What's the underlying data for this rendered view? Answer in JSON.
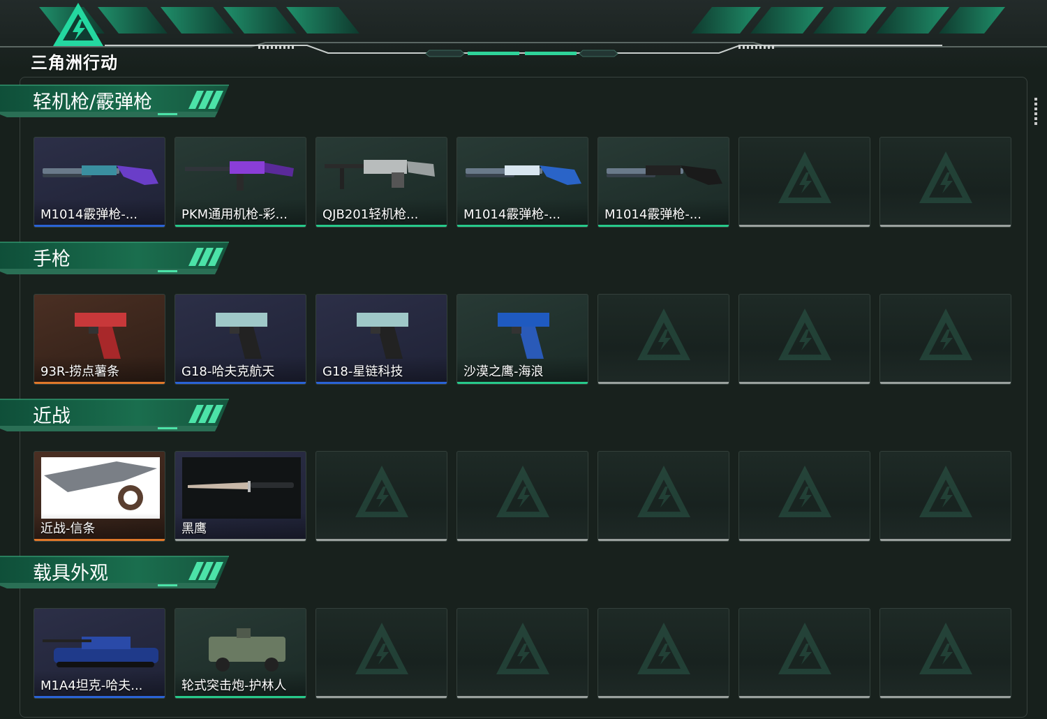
{
  "header": {
    "logo_text": "三角洲行动",
    "brand_color": "#2fd49a"
  },
  "colors": {
    "quality_blue": "#2a63d6",
    "quality_green": "#27c98a",
    "quality_orange": "#e0782a",
    "quality_empty": "#9aa19e"
  },
  "sections": [
    {
      "title": "轻机枪/霰弹枪",
      "items": [
        {
          "name": "M1014霰弹枪-...",
          "quality": "blue",
          "icon": "shotgun-icon"
        },
        {
          "name": "PKM通用机枪-彩...",
          "quality": "green",
          "icon": "machine-gun-icon"
        },
        {
          "name": "QJB201轻机枪...",
          "quality": "green",
          "icon": "light-machine-gun-icon"
        },
        {
          "name": "M1014霰弹枪-...",
          "quality": "green",
          "icon": "shotgun-icon"
        },
        {
          "name": "M1014霰弹枪-...",
          "quality": "green",
          "icon": "shotgun-icon"
        },
        {
          "name": "",
          "quality": "empty",
          "icon": "empty-slot-icon"
        },
        {
          "name": "",
          "quality": "empty",
          "icon": "empty-slot-icon"
        }
      ]
    },
    {
      "title": "手枪",
      "items": [
        {
          "name": "93R-捞点薯条",
          "quality": "orange",
          "icon": "pistol-icon"
        },
        {
          "name": "G18-哈夫克航天",
          "quality": "blue",
          "icon": "pistol-icon"
        },
        {
          "name": "G18-星链科技",
          "quality": "blue",
          "icon": "pistol-icon"
        },
        {
          "name": "沙漠之鹰-海浪",
          "quality": "green",
          "icon": "pistol-icon"
        },
        {
          "name": "",
          "quality": "empty",
          "icon": "empty-slot-icon"
        },
        {
          "name": "",
          "quality": "empty",
          "icon": "empty-slot-icon"
        },
        {
          "name": "",
          "quality": "empty",
          "icon": "empty-slot-icon"
        }
      ]
    },
    {
      "title": "近战",
      "items": [
        {
          "name": "近战-信条",
          "quality": "orange",
          "icon": "knife-icon"
        },
        {
          "name": "黑鹰",
          "quality": "empty",
          "icon": "knife-icon"
        },
        {
          "name": "",
          "quality": "empty",
          "icon": "empty-slot-icon"
        },
        {
          "name": "",
          "quality": "empty",
          "icon": "empty-slot-icon"
        },
        {
          "name": "",
          "quality": "empty",
          "icon": "empty-slot-icon"
        },
        {
          "name": "",
          "quality": "empty",
          "icon": "empty-slot-icon"
        },
        {
          "name": "",
          "quality": "empty",
          "icon": "empty-slot-icon"
        }
      ]
    },
    {
      "title": "载具外观",
      "items": [
        {
          "name": "M1A4坦克-哈夫...",
          "quality": "blue",
          "icon": "tank-icon"
        },
        {
          "name": "轮式突击炮-护林人",
          "quality": "green",
          "icon": "armored-vehicle-icon"
        },
        {
          "name": "",
          "quality": "empty",
          "icon": "empty-slot-icon"
        },
        {
          "name": "",
          "quality": "empty",
          "icon": "empty-slot-icon"
        },
        {
          "name": "",
          "quality": "empty",
          "icon": "empty-slot-icon"
        },
        {
          "name": "",
          "quality": "empty",
          "icon": "empty-slot-icon"
        },
        {
          "name": "",
          "quality": "empty",
          "icon": "empty-slot-icon"
        }
      ]
    }
  ]
}
